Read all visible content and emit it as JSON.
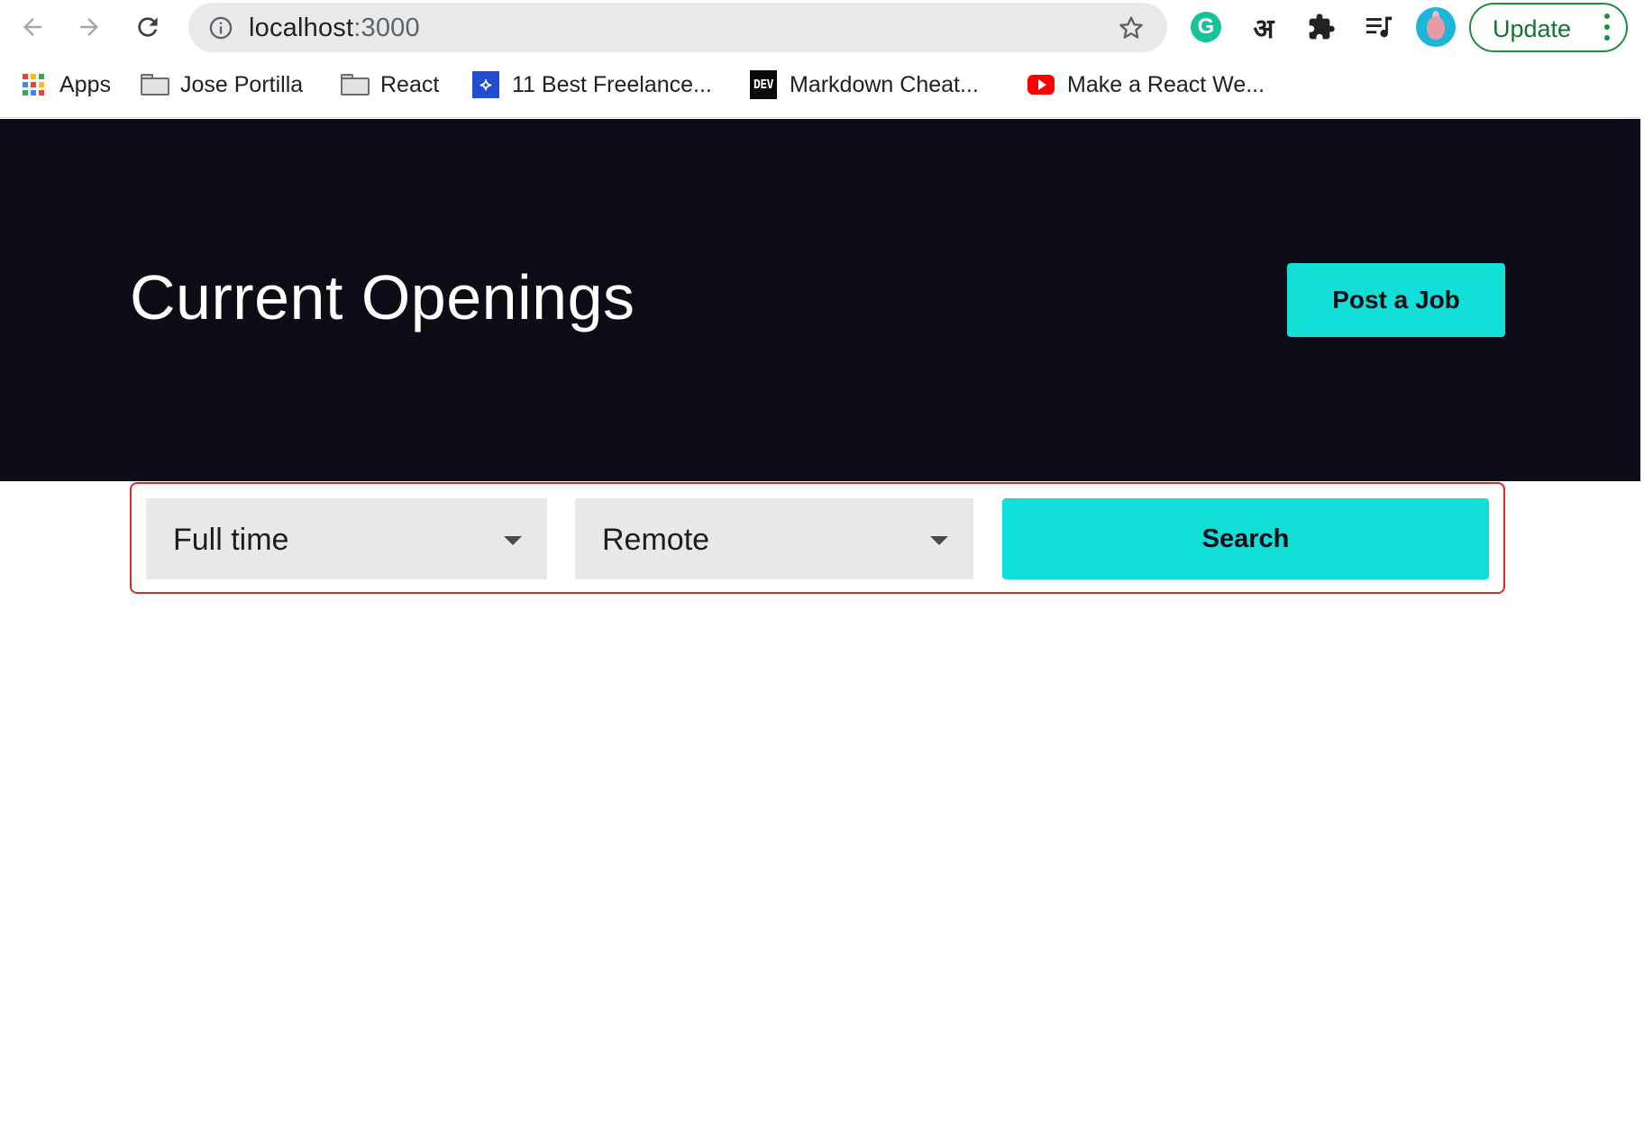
{
  "browser": {
    "url_host": "localhost",
    "url_port": ":3000",
    "update_label": "Update",
    "bookmarks": [
      {
        "label": "Apps",
        "icon": "apps-grid-icon"
      },
      {
        "label": "Jose Portilla",
        "icon": "folder-icon"
      },
      {
        "label": "React",
        "icon": "folder-icon"
      },
      {
        "label": "11 Best Freelance...",
        "icon": "toptal-icon"
      },
      {
        "label": "Markdown Cheat...",
        "icon": "dev-to-icon"
      },
      {
        "label": "Make a React We...",
        "icon": "youtube-icon"
      }
    ],
    "extensions": {
      "grammarly_letter": "G",
      "translate_glyph": "अ",
      "dev_to_text": "DEV"
    }
  },
  "hero": {
    "title": "Current Openings",
    "post_job_label": "Post a Job",
    "background": "#0b0c15",
    "accent": "#11dfd7"
  },
  "filters": {
    "job_type": "Full time",
    "location": "Remote",
    "search_label": "Search",
    "outline_color": "#e0282c"
  }
}
